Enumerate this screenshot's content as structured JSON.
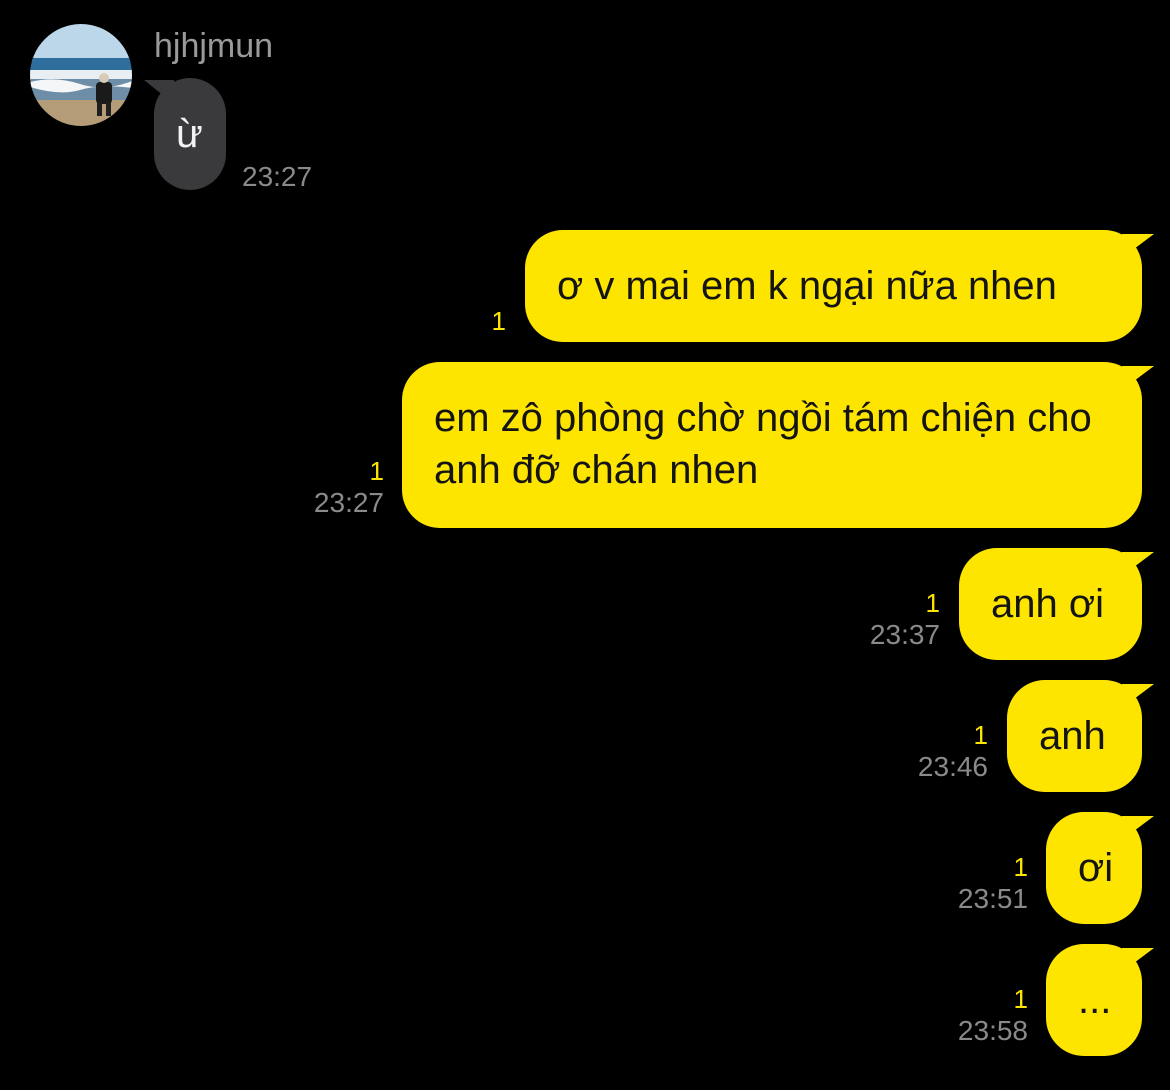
{
  "contact": {
    "name": "hjhjmun",
    "avatar": "beach-photo-avatar"
  },
  "incoming": [
    {
      "text": "ừ",
      "time": "23:27"
    }
  ],
  "outgoing": [
    {
      "text": "ơ v mai em k ngại nữa nhen",
      "read_count": "1",
      "time": ""
    },
    {
      "text": "em zô phòng chờ ngồi tám chiện cho anh đỡ chán nhen",
      "read_count": "1",
      "time": "23:27"
    },
    {
      "text": "anh ơi",
      "read_count": "1",
      "time": "23:37"
    },
    {
      "text": "anh",
      "read_count": "1",
      "time": "23:46"
    },
    {
      "text": "ơi",
      "read_count": "1",
      "time": "23:51"
    },
    {
      "text": "...",
      "read_count": "1",
      "time": "23:58"
    }
  ],
  "colors": {
    "background": "#000000",
    "outgoing_bubble": "#fee500",
    "incoming_bubble": "#3a3a3c",
    "read_count": "#fee500",
    "timestamp": "#8a8a8a"
  }
}
